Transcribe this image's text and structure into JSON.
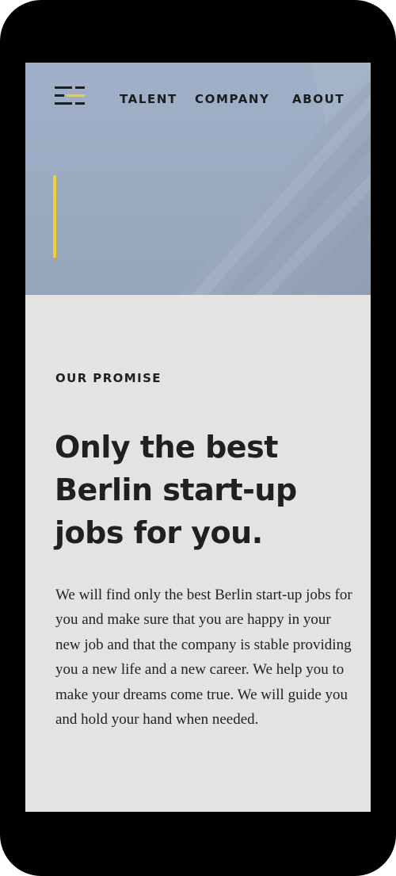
{
  "nav": {
    "items": [
      {
        "label": "TALENT"
      },
      {
        "label": "COMPANY"
      },
      {
        "label": "ABOUT"
      }
    ]
  },
  "logo": {
    "icon": "menu-lines-icon"
  },
  "promise": {
    "eyebrow": "OUR PROMISE",
    "headline": "Only the best Berlin start-up jobs for you.",
    "body": "We will find only the best Berlin start-up jobs for you and make sure that you are happy in your new job and that the company is stable providing you a new life and a new career. We help you to make your dreams come true. We will guide you and hold your hand when needed."
  },
  "colors": {
    "accent": "#f2d21b",
    "hero_sky": "#9fb0c8",
    "content_bg": "#e3e3e3",
    "text": "#202020",
    "frame": "#000000"
  }
}
